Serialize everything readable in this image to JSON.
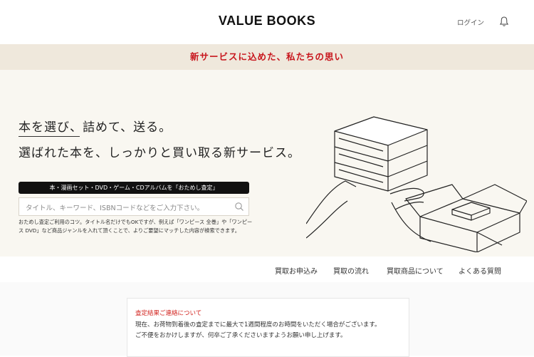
{
  "header": {
    "logo": "VALUE BOOKS",
    "login_label": "ログイン",
    "bell_icon": "bell-icon"
  },
  "banner": {
    "text": "新サービスに込めた、私たちの思い"
  },
  "hero": {
    "headline_1": "本を選び、詰めて、送る。",
    "headline_2": "選ばれた本を、しっかりと買い取る新サービス。",
    "pill_label": "本・漫画セット・DVD・ゲーム・CDアルバムを「おためし査定」",
    "search_placeholder": "タイトル、キーワード、ISBNコードなどをご入力下さい。",
    "search_icon": "search-icon",
    "note": "おためし査定ご利用のコツ。タイトル名だけでもOKですが、例えば「ワンピース 全巻」や「ワンピース DVD」など商品ジャンルを入れて頂くことで、よりご要望にマッチした内容が検索できます。"
  },
  "nav": {
    "items": [
      "買取お申込み",
      "買取の流れ",
      "買取商品について",
      "よくある質問"
    ]
  },
  "notice": {
    "title": "査定結果ご連絡について",
    "line_1": "現在、お荷物到着後の査定までに最大で1週間程度のお時間をいただく場合がございます。",
    "line_2": "ご不便をおかけしますが、何卒ご了承くださいますようお願い申し上げます。"
  },
  "colors": {
    "accent_red": "#c8161d",
    "banner_bg": "#efe8dc",
    "hero_bg": "#f9f7f1"
  }
}
